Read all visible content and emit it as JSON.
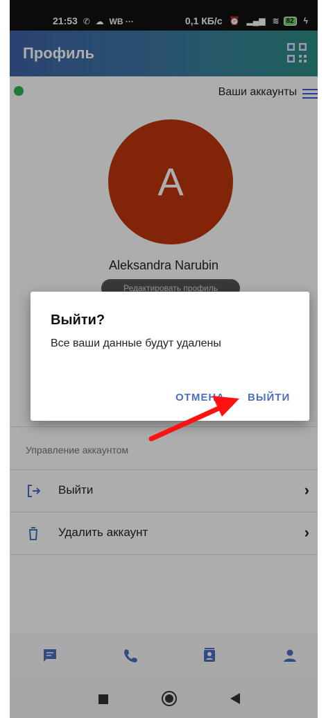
{
  "status_bar": {
    "time": "21:53",
    "extra": "WB ···",
    "speed": "0,1 КБ/с",
    "battery": "82"
  },
  "app_bar": {
    "title": "Профиль"
  },
  "profile": {
    "accounts_link": "Ваши аккаунты",
    "avatar_letter": "A",
    "avatar_color": "#bf360c",
    "name": "Aleksandra Narubin",
    "edit_profile": "Редактировать профиль"
  },
  "account_section": {
    "header": "Управление аккаунтом",
    "logout_label": "Выйти",
    "delete_label": "Удалить аккаунт"
  },
  "dialog": {
    "title": "Выйти?",
    "message": "Все ваши данные будут удалены",
    "cancel": "ОТМЕНА",
    "confirm": "ВЫЙТИ"
  },
  "colors": {
    "accent": "#4a6fbe",
    "online": "#2fb54a",
    "annotation_arrow": "#ff1111"
  },
  "icons": [
    "qr-code-icon",
    "menu-icon",
    "logout-icon",
    "trash-icon",
    "chat-icon",
    "phone-icon",
    "contacts-icon",
    "person-icon"
  ]
}
